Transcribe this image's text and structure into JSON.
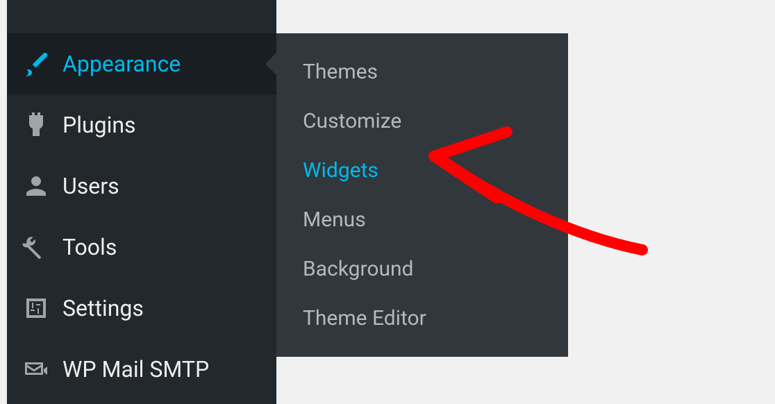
{
  "sidebar": {
    "items": [
      {
        "label": "Appearance",
        "icon": "paintbrush",
        "active": true
      },
      {
        "label": "Plugins",
        "icon": "plugin",
        "active": false
      },
      {
        "label": "Users",
        "icon": "user",
        "active": false
      },
      {
        "label": "Tools",
        "icon": "wrench",
        "active": false
      },
      {
        "label": "Settings",
        "icon": "sliders",
        "active": false
      },
      {
        "label": "WP Mail SMTP",
        "icon": "mail",
        "active": false
      }
    ]
  },
  "submenu": {
    "items": [
      {
        "label": "Themes",
        "active": false
      },
      {
        "label": "Customize",
        "active": false
      },
      {
        "label": "Widgets",
        "active": true
      },
      {
        "label": "Menus",
        "active": false
      },
      {
        "label": "Background",
        "active": false
      },
      {
        "label": "Theme Editor",
        "active": false
      }
    ]
  },
  "annotation": {
    "color": "#ff0000"
  }
}
